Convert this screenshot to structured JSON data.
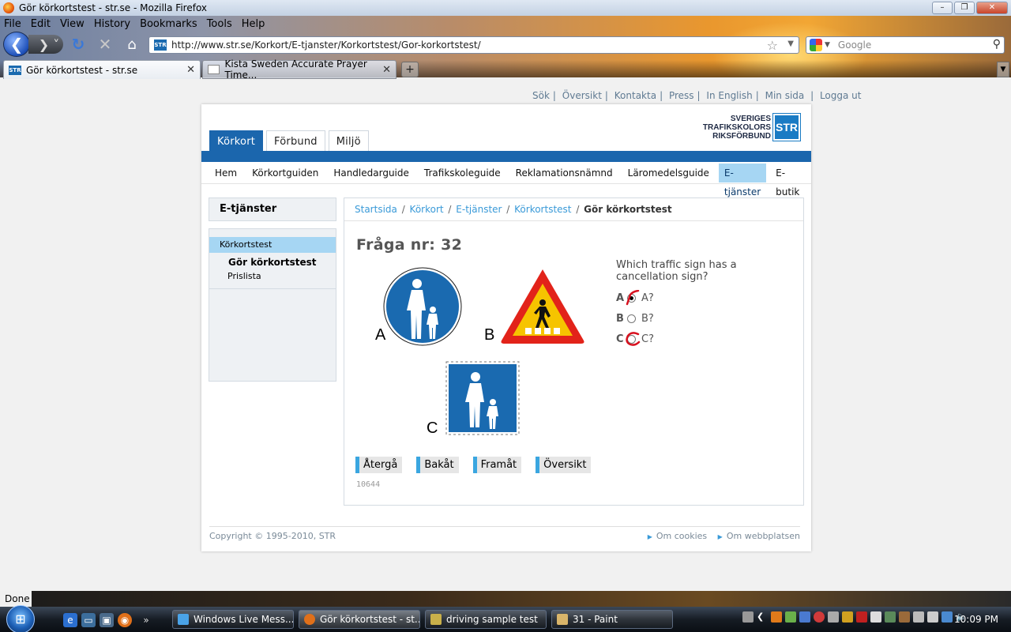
{
  "window": {
    "title": "Gör körkortstest - str.se - Mozilla Firefox"
  },
  "menu": [
    "File",
    "Edit",
    "View",
    "History",
    "Bookmarks",
    "Tools",
    "Help"
  ],
  "nav": {
    "url": "http://www.str.se/Korkort/E-tjanster/Korkortstest/Gor-korkortstest/",
    "search_placeholder": "Google"
  },
  "tabs": [
    {
      "title": "Gör körkortstest - str.se"
    },
    {
      "title": "Kista Sweden Accurate Prayer Time..."
    }
  ],
  "site": {
    "top_links": [
      "Sök",
      "Översikt",
      "Kontakta",
      "Press",
      "In English",
      "Min sida",
      "Logga ut"
    ],
    "brand_words": [
      "SVERIGES",
      "TRAFIKSKOLORS",
      "RIKSFÖRBUND"
    ],
    "brand_abbr": "STR",
    "main_tabs": [
      {
        "label": "Körkort"
      },
      {
        "label": "Förbund"
      },
      {
        "label": "Miljö"
      }
    ],
    "sub_nav": [
      "Hem",
      "Körkortguiden",
      "Handledarguide",
      "Trafikskoleguide",
      "Reklamationsnämnd",
      "Läromedelsguide",
      "E-tjänster",
      "E-butik"
    ],
    "left_title": "E-tjänster",
    "left_menu": {
      "top": "Körkortstest",
      "sub": [
        "Gör körkortstest",
        "Prislista"
      ]
    },
    "breadcrumbs": [
      "Startsida",
      "Körkort",
      "E-tjänster",
      "Körkortstest"
    ],
    "breadcrumb_current": "Gör körkortstest",
    "question": {
      "title": "Fråga nr: 32",
      "text": "Which traffic sign has a cancellation sign?",
      "sign_labels": [
        "A",
        "B",
        "C"
      ],
      "options": [
        {
          "letter": "A",
          "text": "A?",
          "selected": true
        },
        {
          "letter": "B",
          "text": "B?",
          "selected": false
        },
        {
          "letter": "C",
          "text": "C?",
          "selected": false
        }
      ],
      "buttons": [
        "Återgå",
        "Bakåt",
        "Framåt",
        "Översikt"
      ],
      "id": "10644"
    },
    "footer": {
      "copyright": "Copyright © 1995-2010, STR",
      "links": [
        "Om cookies",
        "Om webbplatsen"
      ]
    }
  },
  "status": {
    "text": "Done"
  },
  "taskbar": {
    "items": [
      "Windows Live Mess...",
      "Gör körkortstest - st...",
      "driving sample test",
      "31 - Paint"
    ],
    "clock": "10:09 PM"
  },
  "colors": {
    "brand_blue": "#1b66ad",
    "active_nav": "#a6d6f3",
    "link": "#3a9ad8",
    "mark_red": "#d8111f"
  }
}
